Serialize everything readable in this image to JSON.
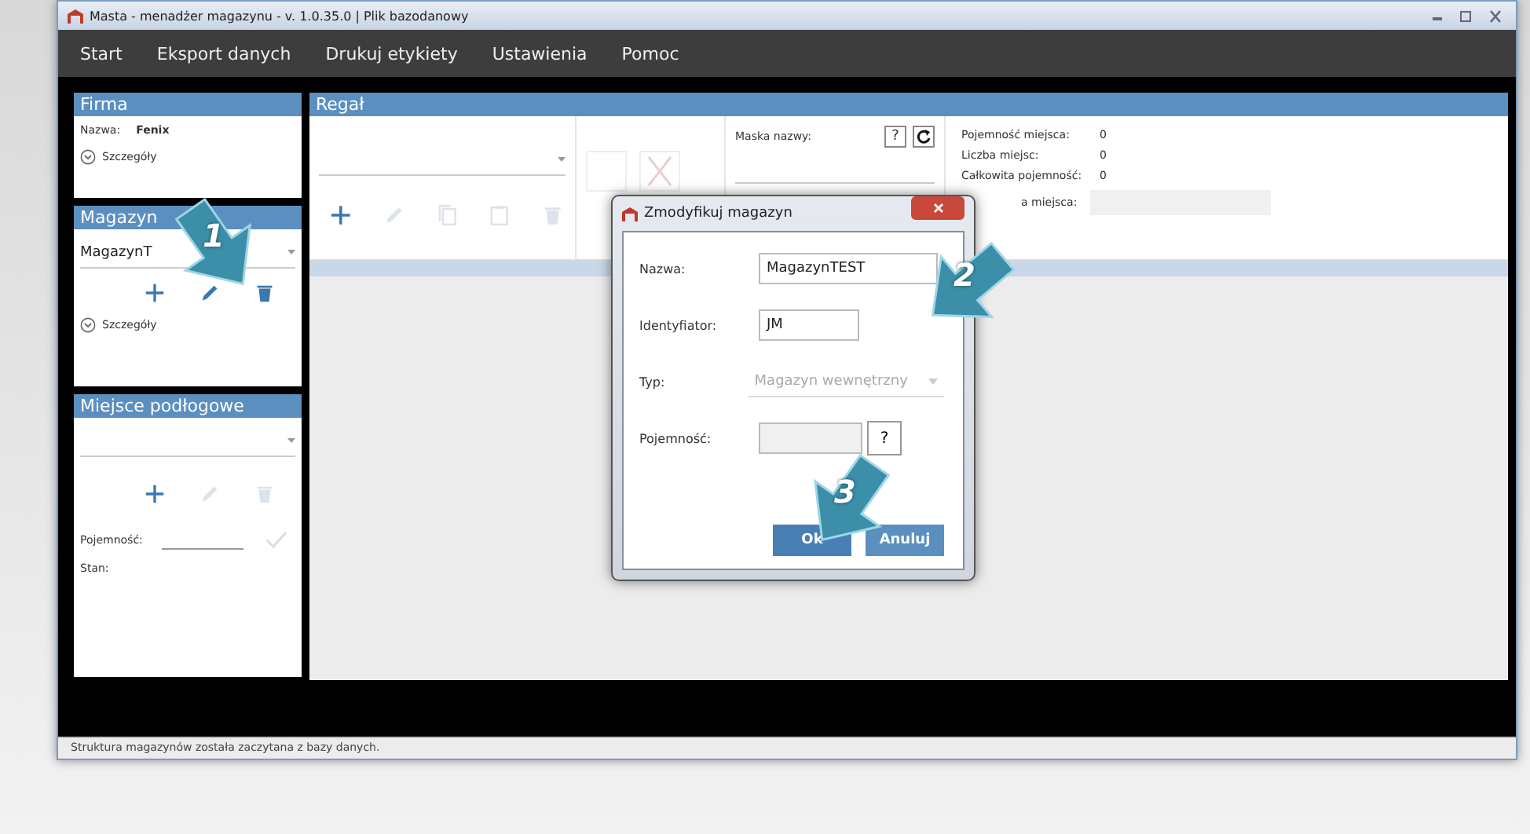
{
  "window": {
    "title": "Masta - menadżer magazynu - v. 1.0.35.0 | Plik bazodanowy"
  },
  "menu": [
    {
      "label": "Start"
    },
    {
      "label": "Eksport danych"
    },
    {
      "label": "Drukuj etykiety"
    },
    {
      "label": "Ustawienia"
    },
    {
      "label": "Pomoc"
    }
  ],
  "firma": {
    "title": "Firma",
    "name_label": "Nazwa:",
    "name_value": "Fenix",
    "details": "Szczegóły"
  },
  "magazyn": {
    "title": "Magazyn",
    "value": "MagazynT",
    "tools": [
      {
        "kind": "add",
        "disabled": false
      },
      {
        "kind": "edit",
        "disabled": false
      },
      {
        "kind": "delete",
        "disabled": false
      }
    ],
    "details": "Szczegóły"
  },
  "miejsce": {
    "title": "Miejsce podłogowe",
    "tools": [
      {
        "kind": "add",
        "disabled": false
      },
      {
        "kind": "edit",
        "disabled": true
      },
      {
        "kind": "delete",
        "disabled": true
      }
    ],
    "capacity_label": "Pojemność:",
    "state_label": "Stan:"
  },
  "regal": {
    "title": "Regał",
    "tools": [
      {
        "kind": "add",
        "disabled": false
      },
      {
        "kind": "edit",
        "disabled": true
      },
      {
        "kind": "copy",
        "disabled": true
      },
      {
        "kind": "paste",
        "disabled": true
      },
      {
        "kind": "delete",
        "disabled": true
      }
    ],
    "mask_label": "Maska nazwy:",
    "mask_help": "?",
    "stats": [
      {
        "label": "Pojemność miejsca:",
        "value": "0"
      },
      {
        "label": "Liczba miejsc:",
        "value": "0"
      },
      {
        "label": "Całkowita pojemność:",
        "value": "0"
      }
    ],
    "place_label": "a miejsca:"
  },
  "dialog": {
    "title": "Zmodyfikuj magazyn",
    "fields": [
      {
        "kind": "text",
        "label": "Nazwa:",
        "value": "MagazynTEST",
        "disabled": false
      },
      {
        "kind": "text",
        "label": "Identyfiator:",
        "value": "JM",
        "disabled": false
      },
      {
        "kind": "select",
        "label": "Typ:",
        "value": "Magazyn wewnętrzny",
        "disabled": true
      },
      {
        "kind": "help",
        "label": "Pojemność:",
        "help": "?",
        "disabled": true
      }
    ],
    "buttons": [
      {
        "label": "Ok",
        "kind": "primary"
      },
      {
        "label": "Anuluj",
        "kind": "secondary"
      }
    ]
  },
  "callouts": [
    {
      "label": "1"
    },
    {
      "label": "2"
    },
    {
      "label": "3"
    }
  ],
  "status_bar": "Struktura magazynów została zaczytana z bazy danych."
}
